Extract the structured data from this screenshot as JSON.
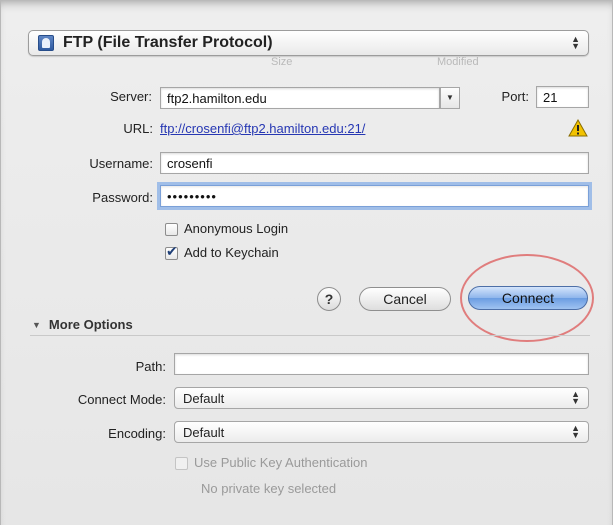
{
  "protocol": {
    "label": "FTP (File Transfer Protocol)"
  },
  "background_columns": {
    "size": "Size",
    "modified": "Modified"
  },
  "server": {
    "label": "Server:",
    "value": "ftp2.hamilton.edu"
  },
  "port": {
    "label": "Port:",
    "value": "21"
  },
  "url": {
    "label": "URL:",
    "link": "ftp://crosenfi@ftp2.hamilton.edu:21/"
  },
  "username": {
    "label": "Username:",
    "value": "crosenfi"
  },
  "password": {
    "label": "Password:",
    "value": "•••••••••"
  },
  "options": {
    "anonymous_login": {
      "label": "Anonymous Login",
      "checked": false
    },
    "add_to_keychain": {
      "label": "Add to Keychain",
      "checked": true
    }
  },
  "buttons": {
    "help": "?",
    "cancel": "Cancel",
    "connect": "Connect"
  },
  "more_options": {
    "title": "More Options",
    "path": {
      "label": "Path:",
      "value": ""
    },
    "connect_mode": {
      "label": "Connect Mode:",
      "value": "Default"
    },
    "encoding": {
      "label": "Encoding:",
      "value": "Default"
    },
    "public_key_auth": {
      "label": "Use Public Key Authentication",
      "checked": false,
      "enabled": false
    },
    "private_key_status": "No private key selected"
  },
  "colors": {
    "accent": "#6b9de2",
    "highlight_circle": "#e07d7d",
    "link": "#2637b3",
    "warning": "#f2c200"
  }
}
